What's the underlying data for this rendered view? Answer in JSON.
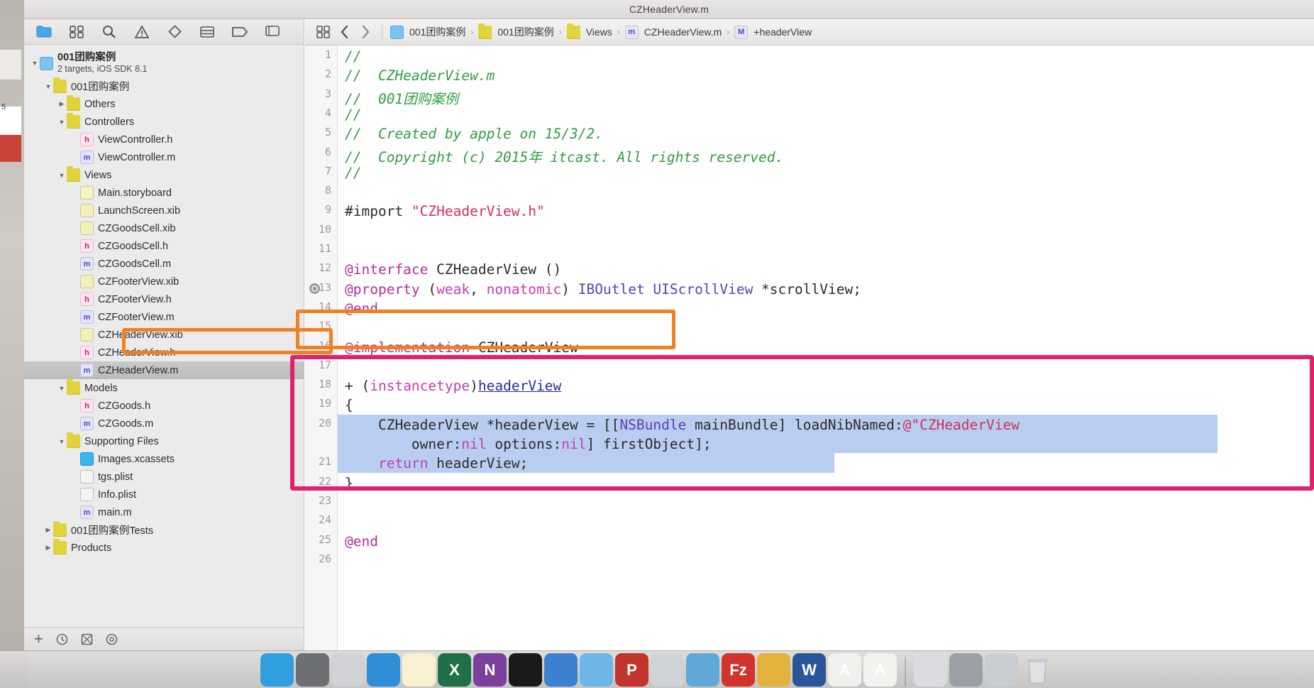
{
  "window": {
    "title": "CZHeaderView.m"
  },
  "navigator": {
    "icons": [
      {
        "name": "project-navigator-icon",
        "glyph": "folder"
      },
      {
        "name": "symbol-navigator-icon",
        "glyph": "symbols"
      },
      {
        "name": "find-navigator-icon",
        "glyph": "search"
      },
      {
        "name": "issue-navigator-icon",
        "glyph": "warning"
      },
      {
        "name": "test-navigator-icon",
        "glyph": "diamond"
      },
      {
        "name": "debug-navigator-icon",
        "glyph": "bars"
      },
      {
        "name": "breakpoint-navigator-icon",
        "glyph": "flag"
      },
      {
        "name": "report-navigator-icon",
        "glyph": "speech"
      }
    ],
    "tree": [
      {
        "label": "001团购案例",
        "sublabel": "2 targets, iOS SDK 8.1",
        "icon": "proj",
        "indent": 0,
        "twisty": "open",
        "bold": true
      },
      {
        "label": "001团购案例",
        "icon": "folder",
        "indent": 1,
        "twisty": "open"
      },
      {
        "label": "Others",
        "icon": "folder",
        "indent": 2,
        "twisty": "closed"
      },
      {
        "label": "Controllers",
        "icon": "folder",
        "indent": 2,
        "twisty": "open"
      },
      {
        "label": "ViewController.h",
        "icon": "h",
        "indent": 3,
        "twisty": "none"
      },
      {
        "label": "ViewController.m",
        "icon": "m",
        "indent": 3,
        "twisty": "none"
      },
      {
        "label": "Views",
        "icon": "folder",
        "indent": 2,
        "twisty": "open"
      },
      {
        "label": "Main.storyboard",
        "icon": "sb",
        "indent": 3,
        "twisty": "none"
      },
      {
        "label": "LaunchScreen.xib",
        "icon": "xib",
        "indent": 3,
        "twisty": "none"
      },
      {
        "label": "CZGoodsCell.xib",
        "icon": "xib",
        "indent": 3,
        "twisty": "none"
      },
      {
        "label": "CZGoodsCell.h",
        "icon": "h",
        "indent": 3,
        "twisty": "none"
      },
      {
        "label": "CZGoodsCell.m",
        "icon": "m",
        "indent": 3,
        "twisty": "none"
      },
      {
        "label": "CZFooterView.xib",
        "icon": "xib",
        "indent": 3,
        "twisty": "none"
      },
      {
        "label": "CZFooterView.h",
        "icon": "h",
        "indent": 3,
        "twisty": "none"
      },
      {
        "label": "CZFooterView.m",
        "icon": "m",
        "indent": 3,
        "twisty": "none"
      },
      {
        "label": "CZHeaderView.xib",
        "icon": "xib",
        "indent": 3,
        "twisty": "none"
      },
      {
        "label": "CZHeaderView.h",
        "icon": "h",
        "indent": 3,
        "twisty": "none"
      },
      {
        "label": "CZHeaderView.m",
        "icon": "m",
        "indent": 3,
        "twisty": "none",
        "selected": true
      },
      {
        "label": "Models",
        "icon": "folder",
        "indent": 2,
        "twisty": "open"
      },
      {
        "label": "CZGoods.h",
        "icon": "h",
        "indent": 3,
        "twisty": "none"
      },
      {
        "label": "CZGoods.m",
        "icon": "m",
        "indent": 3,
        "twisty": "none"
      },
      {
        "label": "Supporting Files",
        "icon": "folder",
        "indent": 2,
        "twisty": "open"
      },
      {
        "label": "Images.xcassets",
        "icon": "asset",
        "indent": 3,
        "twisty": "none"
      },
      {
        "label": "tgs.plist",
        "icon": "plist",
        "indent": 3,
        "twisty": "none"
      },
      {
        "label": "Info.plist",
        "icon": "plist",
        "indent": 3,
        "twisty": "none"
      },
      {
        "label": "main.m",
        "icon": "m",
        "indent": 3,
        "twisty": "none"
      },
      {
        "label": "001团购案例Tests",
        "icon": "folder",
        "indent": 1,
        "twisty": "closed"
      },
      {
        "label": "Products",
        "icon": "folder",
        "indent": 1,
        "twisty": "closed"
      }
    ],
    "footer_icons": [
      {
        "name": "add-file-icon",
        "glyph": "+"
      },
      {
        "name": "recent-filter-icon",
        "glyph": "clock"
      },
      {
        "name": "source-control-filter-icon",
        "glyph": "sourcecontrol"
      },
      {
        "name": "filter-search-icon",
        "glyph": "filter"
      }
    ]
  },
  "jumpbar": {
    "related_items_label": "related-items",
    "back_label": "‹",
    "forward_label": "›",
    "crumbs": [
      {
        "label": "001团购案例",
        "icon": "proj"
      },
      {
        "label": "001团购案例",
        "icon": "folder"
      },
      {
        "label": "Views",
        "icon": "folder"
      },
      {
        "label": "CZHeaderView.m",
        "icon": "m"
      },
      {
        "label": "+headerView",
        "icon": "M"
      }
    ]
  },
  "editor": {
    "lines": [
      {
        "num": "1",
        "segs": [
          {
            "t": "//",
            "c": "cmt"
          }
        ]
      },
      {
        "num": "2",
        "segs": [
          {
            "t": "//  CZHeaderView.m",
            "c": "cmt"
          }
        ]
      },
      {
        "num": "3",
        "segs": [
          {
            "t": "//  001团购案例",
            "c": "cmt"
          }
        ]
      },
      {
        "num": "4",
        "segs": [
          {
            "t": "//",
            "c": "cmt"
          }
        ]
      },
      {
        "num": "5",
        "segs": [
          {
            "t": "//  Created by apple on 15/3/2.",
            "c": "cmt"
          }
        ]
      },
      {
        "num": "6",
        "segs": [
          {
            "t": "//  Copyright (c) 2015年 itcast. All rights reserved.",
            "c": "cmt"
          }
        ]
      },
      {
        "num": "7",
        "segs": [
          {
            "t": "//",
            "c": "cmt"
          }
        ]
      },
      {
        "num": "8",
        "segs": []
      },
      {
        "num": "9",
        "segs": [
          {
            "t": "#import ",
            "c": "pre"
          },
          {
            "t": "\"CZHeaderView.h\"",
            "c": "str"
          }
        ]
      },
      {
        "num": "10",
        "segs": []
      },
      {
        "num": "11",
        "segs": []
      },
      {
        "num": "12",
        "segs": [
          {
            "t": "@interface",
            "c": "kw"
          },
          {
            "t": " CZHeaderView ()",
            "c": "plain"
          }
        ]
      },
      {
        "num": "13",
        "segs": [
          {
            "t": "@property",
            "c": "kw"
          },
          {
            "t": " (",
            "c": "plain"
          },
          {
            "t": "weak",
            "c": "kw2"
          },
          {
            "t": ", ",
            "c": "plain"
          },
          {
            "t": "nonatomic",
            "c": "kw2"
          },
          {
            "t": ") ",
            "c": "plain"
          },
          {
            "t": "IBOutlet UIScrollView",
            "c": "type"
          },
          {
            "t": " *scrollView;",
            "c": "plain"
          }
        ],
        "breakpoint": true
      },
      {
        "num": "14",
        "segs": [
          {
            "t": "@end",
            "c": "kw"
          }
        ]
      },
      {
        "num": "15",
        "segs": []
      },
      {
        "num": "16",
        "segs": [
          {
            "t": "@implementation",
            "c": "kw"
          },
          {
            "t": " CZHeaderView",
            "c": "plain"
          }
        ]
      },
      {
        "num": "17",
        "segs": []
      },
      {
        "num": "18",
        "segs": [
          {
            "t": "+ (",
            "c": "plain"
          },
          {
            "t": "instancetype",
            "c": "kw2"
          },
          {
            "t": ")",
            "c": "plain"
          },
          {
            "t": "headerView",
            "c": "ulink"
          }
        ]
      },
      {
        "num": "19",
        "segs": [
          {
            "t": "{",
            "c": "plain"
          }
        ]
      },
      {
        "num": "20",
        "segs": [
          {
            "t": "    CZHeaderView *headerView = [[",
            "c": "plain"
          },
          {
            "t": "NSBundle",
            "c": "type"
          },
          {
            "t": " mainBundle] loadNibNamed:",
            "c": "plain"
          },
          {
            "t": "@\"CZHeaderView",
            "c": "str"
          }
        ]
      },
      {
        "num": "",
        "segs": [
          {
            "t": "        owner:",
            "c": "plain"
          },
          {
            "t": "nil",
            "c": "kw2"
          },
          {
            "t": " options:",
            "c": "plain"
          },
          {
            "t": "nil",
            "c": "kw2"
          },
          {
            "t": "] firstObject];",
            "c": "plain"
          }
        ]
      },
      {
        "num": "21",
        "segs": [
          {
            "t": "    ",
            "c": "plain"
          },
          {
            "t": "return",
            "c": "kw2"
          },
          {
            "t": " headerView;",
            "c": "plain"
          }
        ]
      },
      {
        "num": "22",
        "segs": [
          {
            "t": "}",
            "c": "plain"
          }
        ]
      },
      {
        "num": "23",
        "segs": []
      },
      {
        "num": "24",
        "segs": []
      },
      {
        "num": "25",
        "segs": [
          {
            "t": "@end",
            "c": "kw"
          }
        ]
      },
      {
        "num": "26",
        "segs": []
      }
    ]
  },
  "annotations": {
    "orange_tree_label": "CZHeaderView.m file highlight",
    "orange_code_label": "@implementation CZHeaderView highlight",
    "pink_code_label": "headerView factory method highlight",
    "orange_color": "#f08122",
    "pink_color": "#e0216c",
    "selection_color": "#b9cdf0"
  },
  "dock": {
    "items": [
      {
        "name": "finder-icon",
        "label": "",
        "color": "#2f9fe0"
      },
      {
        "name": "system-preferences-icon",
        "label": "",
        "color": "#6d6f72"
      },
      {
        "name": "launchpad-icon",
        "label": "",
        "color": "#d0d2d5"
      },
      {
        "name": "safari-icon",
        "label": "",
        "color": "#2e8fd8"
      },
      {
        "name": "notes-icon",
        "label": "",
        "color": "#f7f1cf"
      },
      {
        "name": "excel-icon",
        "label": "X",
        "color": "#1f7145"
      },
      {
        "name": "onenote-icon",
        "label": "N",
        "color": "#7b3f9d"
      },
      {
        "name": "terminal-icon",
        "label": "",
        "color": "#1a1a1a"
      },
      {
        "name": "xcode-icon",
        "label": "",
        "color": "#3d7fd0"
      },
      {
        "name": "folder-icon",
        "label": "",
        "color": "#6fb6e8"
      },
      {
        "name": "keynote-icon",
        "label": "P",
        "color": "#c2352c"
      },
      {
        "name": "snipping-icon",
        "label": "",
        "color": "#cfd2d6"
      },
      {
        "name": "photos-icon",
        "label": "",
        "color": "#5fa8d8"
      },
      {
        "name": "filezilla-icon",
        "label": "Fz",
        "color": "#d0342c"
      },
      {
        "name": "utility-icon",
        "label": "",
        "color": "#e3b23c"
      },
      {
        "name": "word-icon",
        "label": "W",
        "color": "#2a5699"
      },
      {
        "name": "fontbook-icon",
        "label": "A",
        "color": "#f2f0ec"
      },
      {
        "name": "preview-icon",
        "label": "A",
        "color": "#f4f2ee"
      },
      {
        "name": "downloads-stack-icon",
        "label": "",
        "color": "#dadcdf"
      },
      {
        "name": "screen-sharing-icon",
        "label": "",
        "color": "#9aa0a6"
      },
      {
        "name": "display-icon",
        "label": "",
        "color": "#c9ccd0"
      },
      {
        "name": "trash-icon",
        "label": "",
        "color": "#cfd3d7"
      }
    ]
  },
  "watermark": {
    "text": "https://blog.csdn.net/manmanlu2006"
  }
}
